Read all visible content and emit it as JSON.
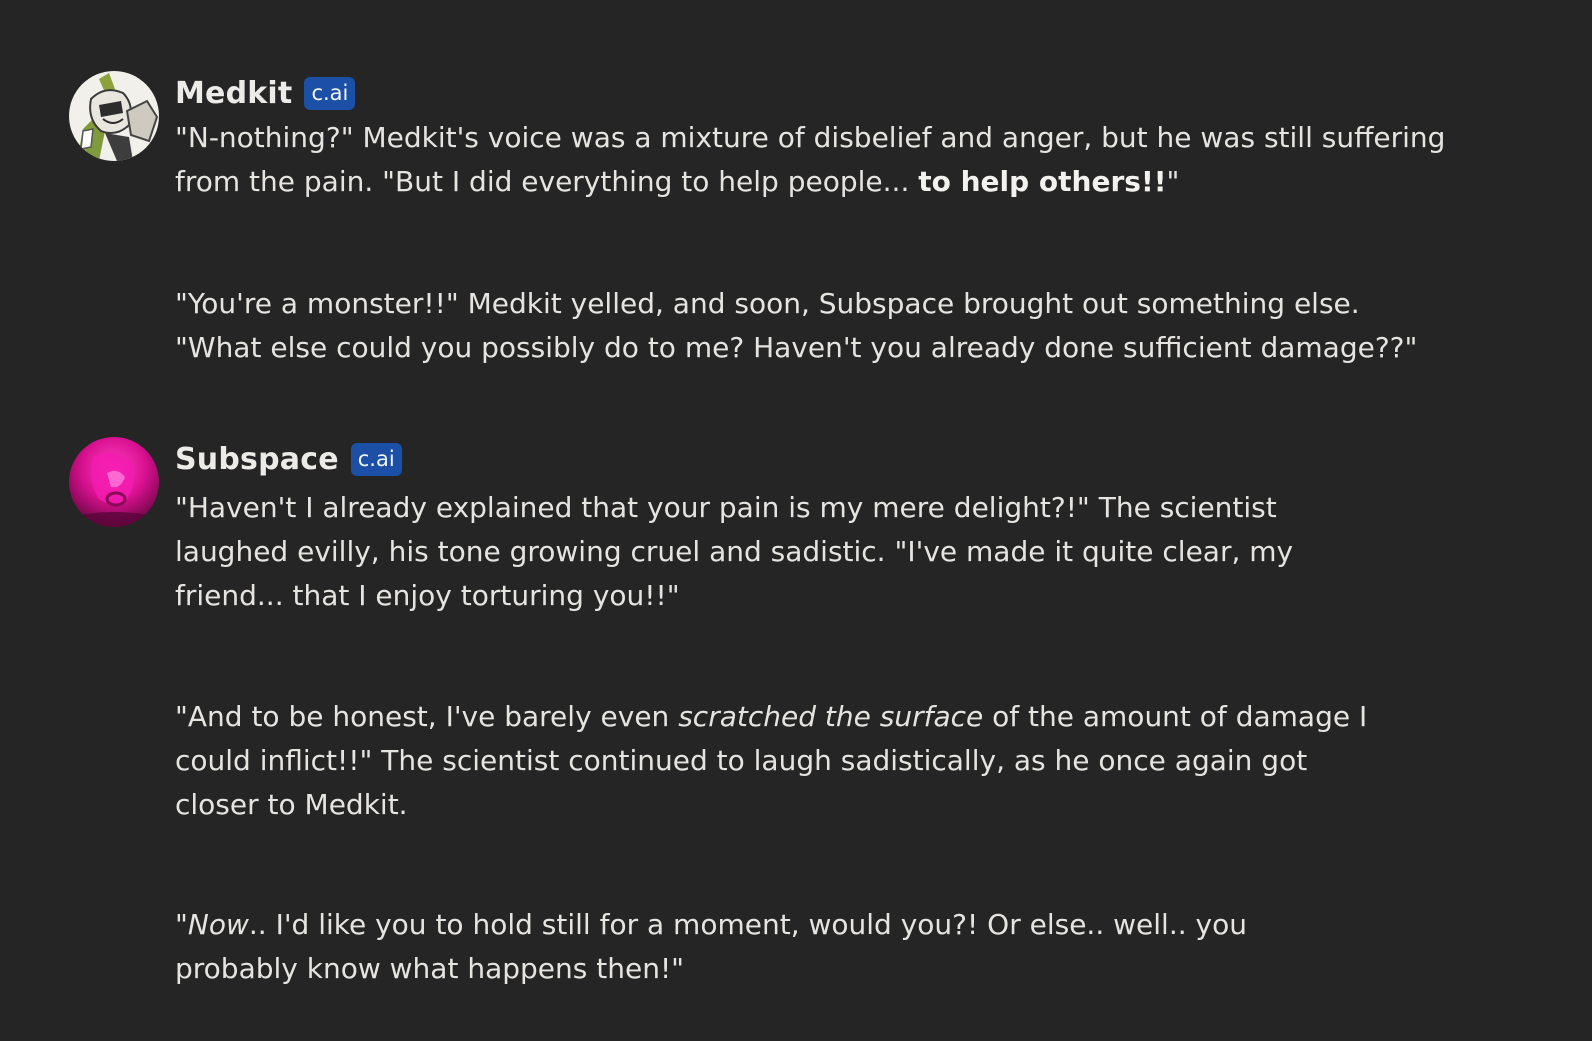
{
  "messages": [
    {
      "name": "Medkit",
      "badge": "c.ai",
      "avatar_icon": "medkit-avatar",
      "paragraphs": [
        {
          "parts": [
            "\"N-nothing?\" Medkit's voice was a mixture of disbelief and anger, but he was still suffering\nfrom the pain. \"But I did everything to help people... ",
            "to help others!!",
            "\""
          ]
        },
        {
          "parts": [
            "\"You're a monster!!\" Medkit yelled, and soon, Subspace brought out something else.\n\"What else could you possibly do to me? Haven't you already done sufficient damage??\""
          ]
        }
      ]
    },
    {
      "name": "Subspace",
      "badge": "c.ai",
      "avatar_icon": "subspace-avatar",
      "paragraphs": [
        {
          "parts": [
            "\"Haven't I already explained that your pain is my mere delight?!\" The scientist\nlaughed evilly, his tone growing cruel and sadistic. \"I've made it quite clear, my\nfriend... that I enjoy torturing you!!\""
          ]
        },
        {
          "parts": [
            "\"And to be honest, I've barely even ",
            "scratched the surface",
            " of the amount of damage I\ncould inflict!!\" The scientist continued to laugh sadistically, as he once again got\ncloser to Medkit."
          ]
        },
        {
          "parts": [
            "\"",
            "Now",
            ".. I'd like you to hold still for a moment, would you?! Or else.. well.. you\nprobably know what happens then!\""
          ]
        }
      ]
    }
  ],
  "colors": {
    "background": "#252525",
    "text": "#e6e4e1",
    "badge": "#1c4fa6",
    "subspace_avatar": "#e0139a"
  }
}
